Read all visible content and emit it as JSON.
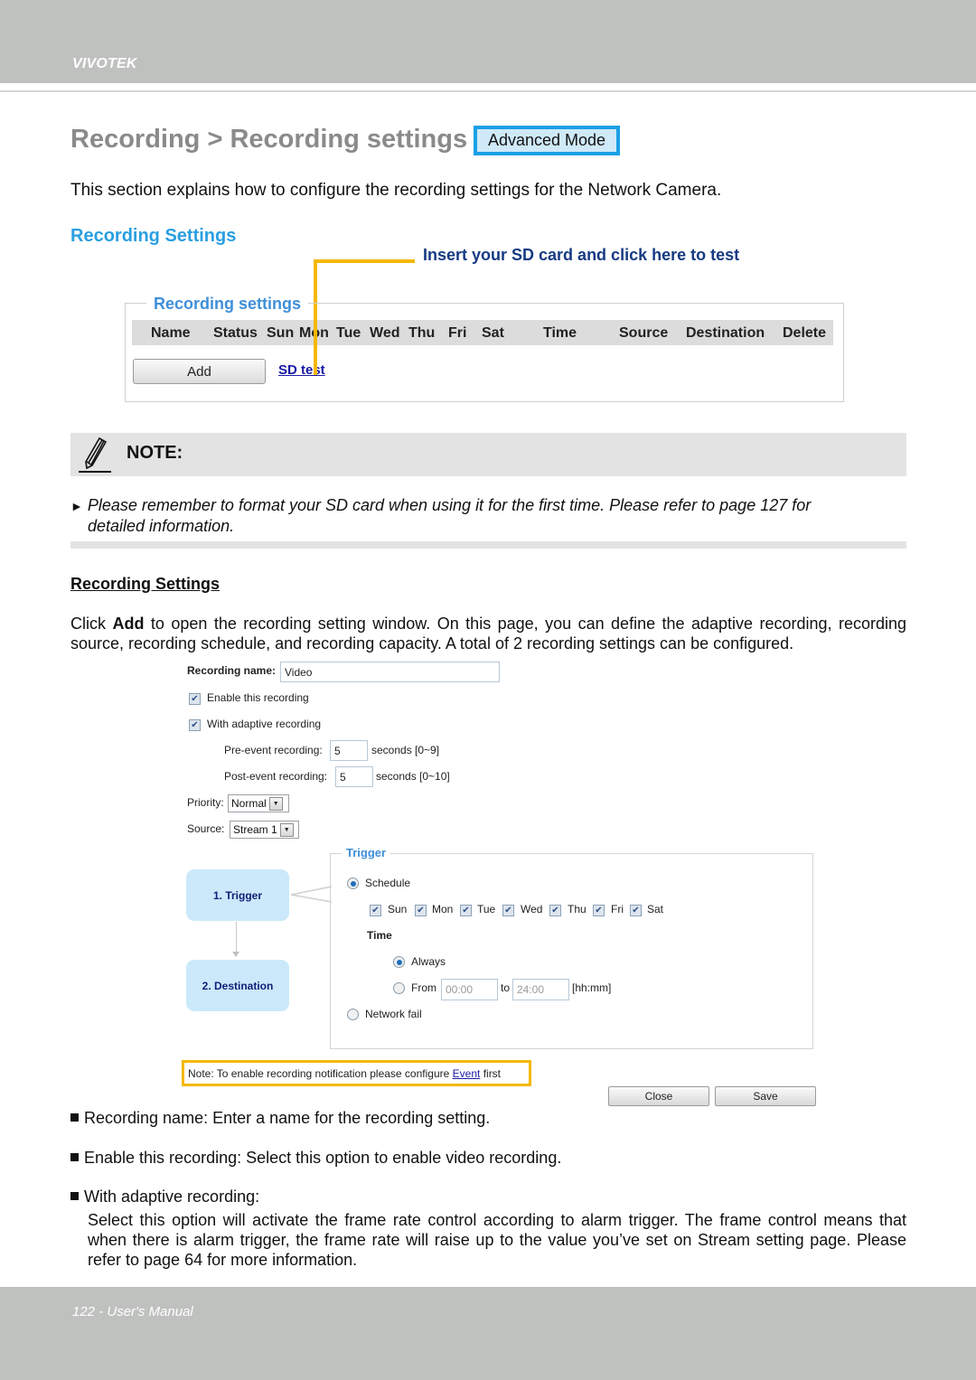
{
  "header": {
    "brand": "VIVOTEK"
  },
  "title": {
    "text": "Recording > Recording settings",
    "mode_badge": "Advanced Mode"
  },
  "intro": "This section explains how to configure the recording settings for the Network Camera.",
  "section_heading": "Recording Settings",
  "callout": "Insert your SD card and click here to test",
  "recording_panel": {
    "legend": "Recording settings",
    "columns": [
      "Name",
      "Status",
      "Sun",
      "Mon",
      "Tue",
      "Wed",
      "Thu",
      "Fri",
      "Sat",
      "Time",
      "Source",
      "Destination",
      "Delete"
    ],
    "add_button": "Add",
    "sd_test_link": "SD test"
  },
  "note": {
    "label": "NOTE:",
    "text_line1": "Please remember to format your SD card when using it for the first time. Please refer to page 127 for",
    "text_line2": "detailed information."
  },
  "subsection": {
    "heading": "Recording Settings",
    "para_before": "Click ",
    "para_bold": "Add",
    "para_after": " to open the recording setting window. On this page, you can define the adaptive recording, recording source, recording schedule, and recording capacity. A total of 2 recording settings can be configured."
  },
  "dialog": {
    "recording_name_label": "Recording name:",
    "recording_name_value": "Video",
    "enable_recording": {
      "label": "Enable this recording",
      "checked": true
    },
    "adaptive_recording": {
      "label": "With adaptive recording",
      "checked": true
    },
    "pre_event": {
      "label": "Pre-event recording:",
      "value": "5",
      "unit": "seconds [0~9]"
    },
    "post_event": {
      "label": "Post-event recording:",
      "value": "5",
      "unit": "seconds [0~10]"
    },
    "priority": {
      "label": "Priority:",
      "value": "Normal"
    },
    "source": {
      "label": "Source:",
      "value": "Stream 1"
    },
    "flow": {
      "step1": "1.  Trigger",
      "step2": "2.  Destination"
    },
    "trigger": {
      "legend": "Trigger",
      "schedule_label": "Schedule",
      "schedule_selected": true,
      "days": [
        {
          "label": "Sun",
          "checked": true
        },
        {
          "label": "Mon",
          "checked": true
        },
        {
          "label": "Tue",
          "checked": true
        },
        {
          "label": "Wed",
          "checked": true
        },
        {
          "label": "Thu",
          "checked": true
        },
        {
          "label": "Fri",
          "checked": true
        },
        {
          "label": "Sat",
          "checked": true
        }
      ],
      "time_label": "Time",
      "always_label": "Always",
      "from_label": "From",
      "from_value": "00:00",
      "to_label": "to",
      "to_value": "24:00",
      "format_hint": "[hh:mm]",
      "network_fail_label": "Network fail"
    },
    "notice_before": "Note: To enable recording notification please configure ",
    "notice_link": "Event",
    "notice_after": " first",
    "close_button": "Close",
    "save_button": "Save"
  },
  "bullets": [
    "Recording name: Enter a name for the recording setting.",
    "Enable this recording: Select this option to enable video recording.",
    "With adaptive recording:"
  ],
  "adaptive_description": "Select this option will activate the frame rate control according to alarm trigger. The frame control means that when there is alarm trigger, the frame rate will raise up to the value you’ve set on Stream setting page. Please refer to page 64 for more information.",
  "footer": {
    "text": "122 - User's Manual"
  }
}
